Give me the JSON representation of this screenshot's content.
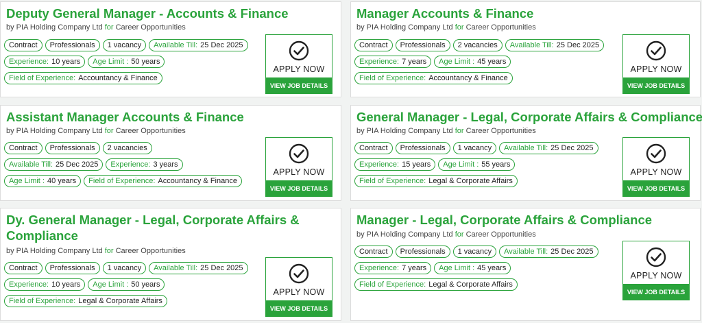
{
  "common": {
    "company": "by PIA Holding Company Ltd",
    "for_word": "for",
    "category": "Career Opportunities",
    "apply_label": "APPLY NOW",
    "details_label": "VIEW JOB DETAILS",
    "accent_color": "#2aa33b",
    "icon": "check-circle-icon"
  },
  "jobs": [
    {
      "title": "Deputy General Manager - Accounts & Finance",
      "contract": "Contract",
      "level": "Professionals",
      "vacancies": "1 vacancy",
      "available_key": "Available Till:",
      "available_val": "25 Dec 2025",
      "experience_key": "Experience:",
      "experience_val": "10 years",
      "age_key": "Age Limit :",
      "age_val": "50 years",
      "field_key": "Field of Experience:",
      "field_val": "Accountancy & Finance"
    },
    {
      "title": "Manager Accounts & Finance",
      "contract": "Contract",
      "level": "Professionals",
      "vacancies": "2 vacancies",
      "available_key": "Available Till:",
      "available_val": "25 Dec 2025",
      "experience_key": "Experience:",
      "experience_val": "7 years",
      "age_key": "Age Limit :",
      "age_val": "45 years",
      "field_key": "Field of Experience:",
      "field_val": "Accountancy & Finance"
    },
    {
      "title": "Assistant Manager Accounts & Finance",
      "contract": "Contract",
      "level": "Professionals",
      "vacancies": "2 vacancies",
      "available_key": "Available Till:",
      "available_val": "25 Dec 2025",
      "experience_key": "Experience:",
      "experience_val": "3 years",
      "age_key": "Age Limit :",
      "age_val": "40 years",
      "field_key": "Field of Experience:",
      "field_val": "Accountancy & Finance"
    },
    {
      "title": "General Manager - Legal, Corporate Affairs & Compliance",
      "contract": "Contract",
      "level": "Professionals",
      "vacancies": "1 vacancy",
      "available_key": "Available Till:",
      "available_val": "25 Dec 2025",
      "experience_key": "Experience:",
      "experience_val": "15 years",
      "age_key": "Age Limit :",
      "age_val": "55 years",
      "field_key": "Field of Experience:",
      "field_val": "Legal & Corporate Affairs"
    },
    {
      "title": "Dy. General Manager - Legal, Corporate Affairs & Compliance",
      "contract": "Contract",
      "level": "Professionals",
      "vacancies": "1 vacancy",
      "available_key": "Available Till:",
      "available_val": "25 Dec 2025",
      "experience_key": "Experience:",
      "experience_val": "10 years",
      "age_key": "Age Limit :",
      "age_val": "50 years",
      "field_key": "Field of Experience:",
      "field_val": "Legal & Corporate Affairs"
    },
    {
      "title": "Manager - Legal, Corporate Affairs & Compliance",
      "contract": "Contract",
      "level": "Professionals",
      "vacancies": "1 vacancy",
      "available_key": "Available Till:",
      "available_val": "25 Dec 2025",
      "experience_key": "Experience:",
      "experience_val": "7 years",
      "age_key": "Age Limit :",
      "age_val": "45 years",
      "field_key": "Field of Experience:",
      "field_val": "Legal & Corporate Affairs"
    }
  ]
}
